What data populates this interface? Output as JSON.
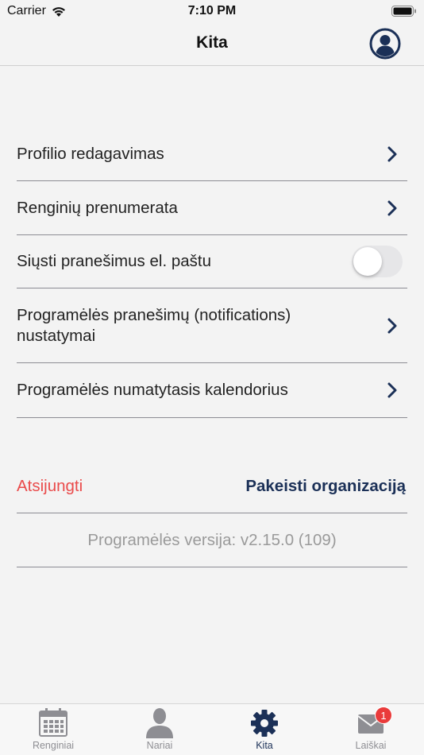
{
  "status_bar": {
    "carrier": "Carrier",
    "time": "7:10 PM"
  },
  "nav": {
    "title": "Kita",
    "profile_icon": "profile-icon"
  },
  "settings": {
    "profile_edit": "Profilio redagavimas",
    "events_subscription": "Renginių prenumerata",
    "email_notifications": "Siųsti pranešimus el. paštu",
    "email_notifications_enabled": false,
    "app_notifications": "Programėlės pranešimų (notifications) nustatymai",
    "default_calendar": "Programėlės numatytasis kalendorius"
  },
  "actions": {
    "logout": "Atsijungti",
    "change_org": "Pakeisti organizaciją"
  },
  "version": "Programėlės versija: v2.15.0 (109)",
  "tabs": [
    {
      "label": "Renginiai",
      "icon": "calendar-icon",
      "active": false
    },
    {
      "label": "Nariai",
      "icon": "person-icon",
      "active": false
    },
    {
      "label": "Kita",
      "icon": "gear-icon",
      "active": true
    },
    {
      "label": "Laiškai",
      "icon": "mail-icon",
      "active": false,
      "badge": "1"
    }
  ],
  "colors": {
    "brand": "#1b3057",
    "danger": "#ea4b4b",
    "badge": "#ea3b3b",
    "muted": "#9a9a9a",
    "background": "#f3f3f3"
  }
}
